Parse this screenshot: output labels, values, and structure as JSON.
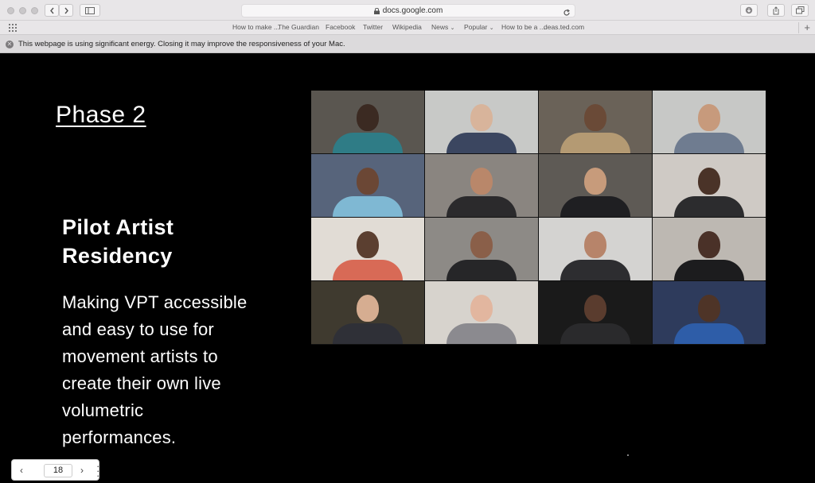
{
  "browser": {
    "url": "docs.google.com",
    "bookmarks": [
      "How to make ...",
      "The Guardian",
      "Facebook",
      "Twitter",
      "Wikipedia",
      "News",
      "Popular",
      "How to be a ...",
      "deas.ted.com"
    ],
    "warning": "This webpage is using significant energy. Closing it may improve the responsiveness of your Mac."
  },
  "slide": {
    "phase": "Phase 2",
    "headline_line1": "Pilot Artist",
    "headline_line2": "Residency",
    "body_lines": [
      "Making VPT accessible",
      "and easy to use for",
      "movement artists to",
      "create their own live",
      "volumetric",
      "performances."
    ]
  },
  "video_grid": {
    "tiles": [
      {
        "bg": "#5a5650",
        "skin": "#3b2a22",
        "shirt": "#2f7c86"
      },
      {
        "bg": "#c8c9c7",
        "skin": "#d8b49b",
        "shirt": "#3b4660"
      },
      {
        "bg": "#6a6258",
        "skin": "#6a4a37",
        "shirt": "#b49a73"
      },
      {
        "bg": "#c7c8c6",
        "skin": "#c79a7c",
        "shirt": "#6f7c90"
      },
      {
        "bg": "#57647b",
        "skin": "#6b4735",
        "shirt": "#7fb8d3"
      },
      {
        "bg": "#8a8580",
        "skin": "#b9876a",
        "shirt": "#2b2a2c"
      },
      {
        "bg": "#5e5a55",
        "skin": "#c79b7b",
        "shirt": "#1f1f22"
      },
      {
        "bg": "#cfcac5",
        "skin": "#4a3328",
        "shirt": "#2c2c2e"
      },
      {
        "bg": "#e1dcd5",
        "skin": "#5b3f30",
        "shirt": "#d86a56"
      },
      {
        "bg": "#8d8a86",
        "skin": "#8a5f49",
        "shirt": "#262628"
      },
      {
        "bg": "#d4d3d1",
        "skin": "#b7846a",
        "shirt": "#2d2d30"
      },
      {
        "bg": "#bdb8b2",
        "skin": "#4a3128",
        "shirt": "#1c1c1e"
      },
      {
        "bg": "#3f3a2f",
        "skin": "#d6ad91",
        "shirt": "#2f3037"
      },
      {
        "bg": "#d7d3cd",
        "skin": "#e2b69f",
        "shirt": "#8b8a8f"
      },
      {
        "bg": "#1a1a1a",
        "skin": "#5a3c2e",
        "shirt": "#2a2a2c"
      },
      {
        "bg": "#2e3b5c",
        "skin": "#4e3427",
        "shirt": "#2e5da8"
      }
    ]
  },
  "pager": {
    "page": "18"
  }
}
